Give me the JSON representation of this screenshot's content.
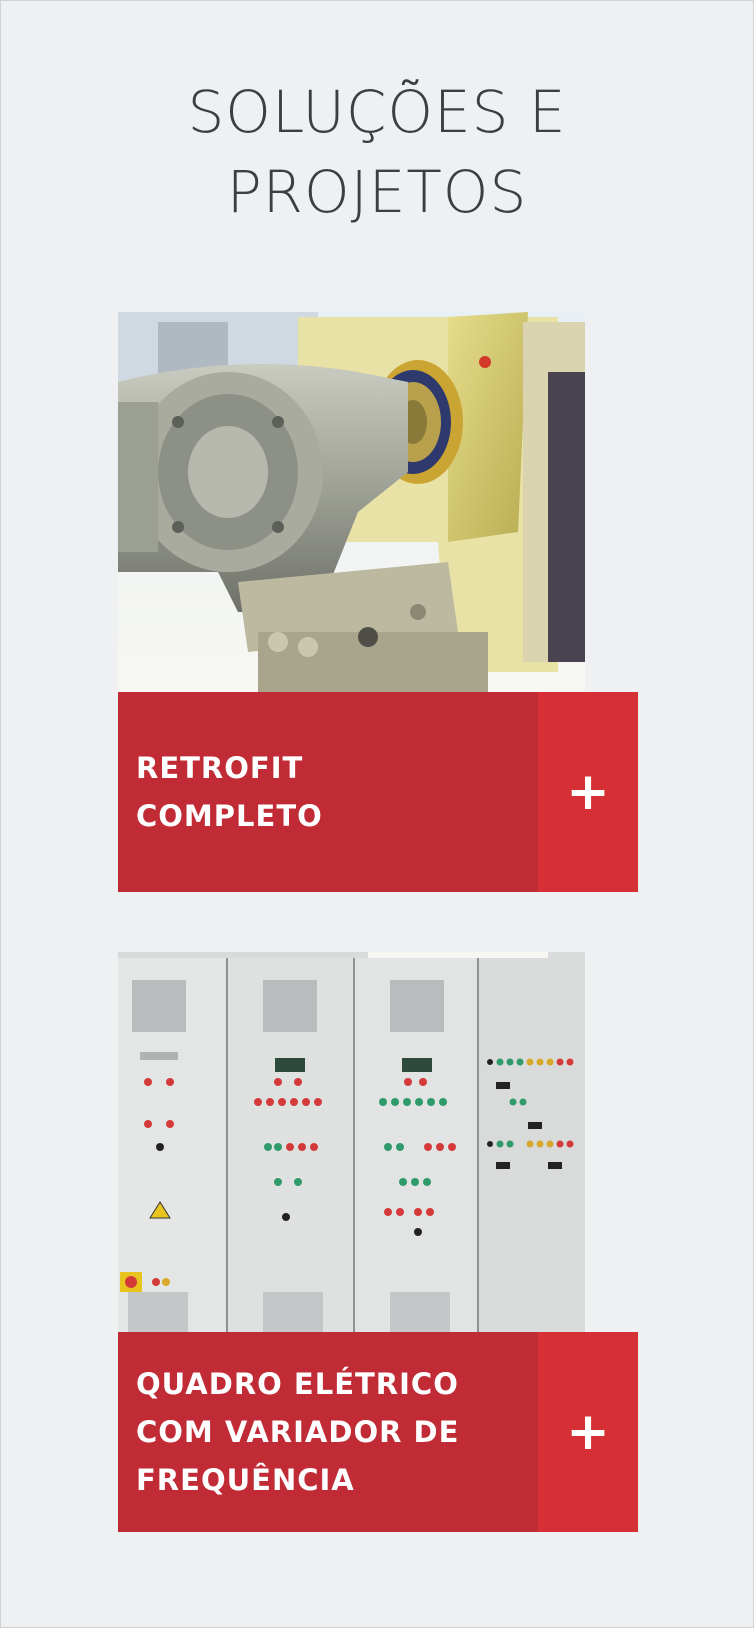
{
  "header": {
    "title_line1": "SOLUÇÕES E",
    "title_line2": "PROJETOS"
  },
  "cards": [
    {
      "image": "industrial-gear-motor-photo",
      "label_line1": "RETROFIT",
      "label_line2": "COMPLETO",
      "label_line3": "",
      "expand_symbol": "+"
    },
    {
      "image": "electrical-panel-cabinet-photo",
      "label_line1": "QUADRO ELÉTRICO",
      "label_line2": "COM VARIADOR DE",
      "label_line3": "FREQUÊNCIA",
      "expand_symbol": "+"
    }
  ],
  "colors": {
    "background": "#eef0f2",
    "bar_red": "#c12b35",
    "plus_red": "#d62f35",
    "title_gray": "#3b3f44"
  }
}
